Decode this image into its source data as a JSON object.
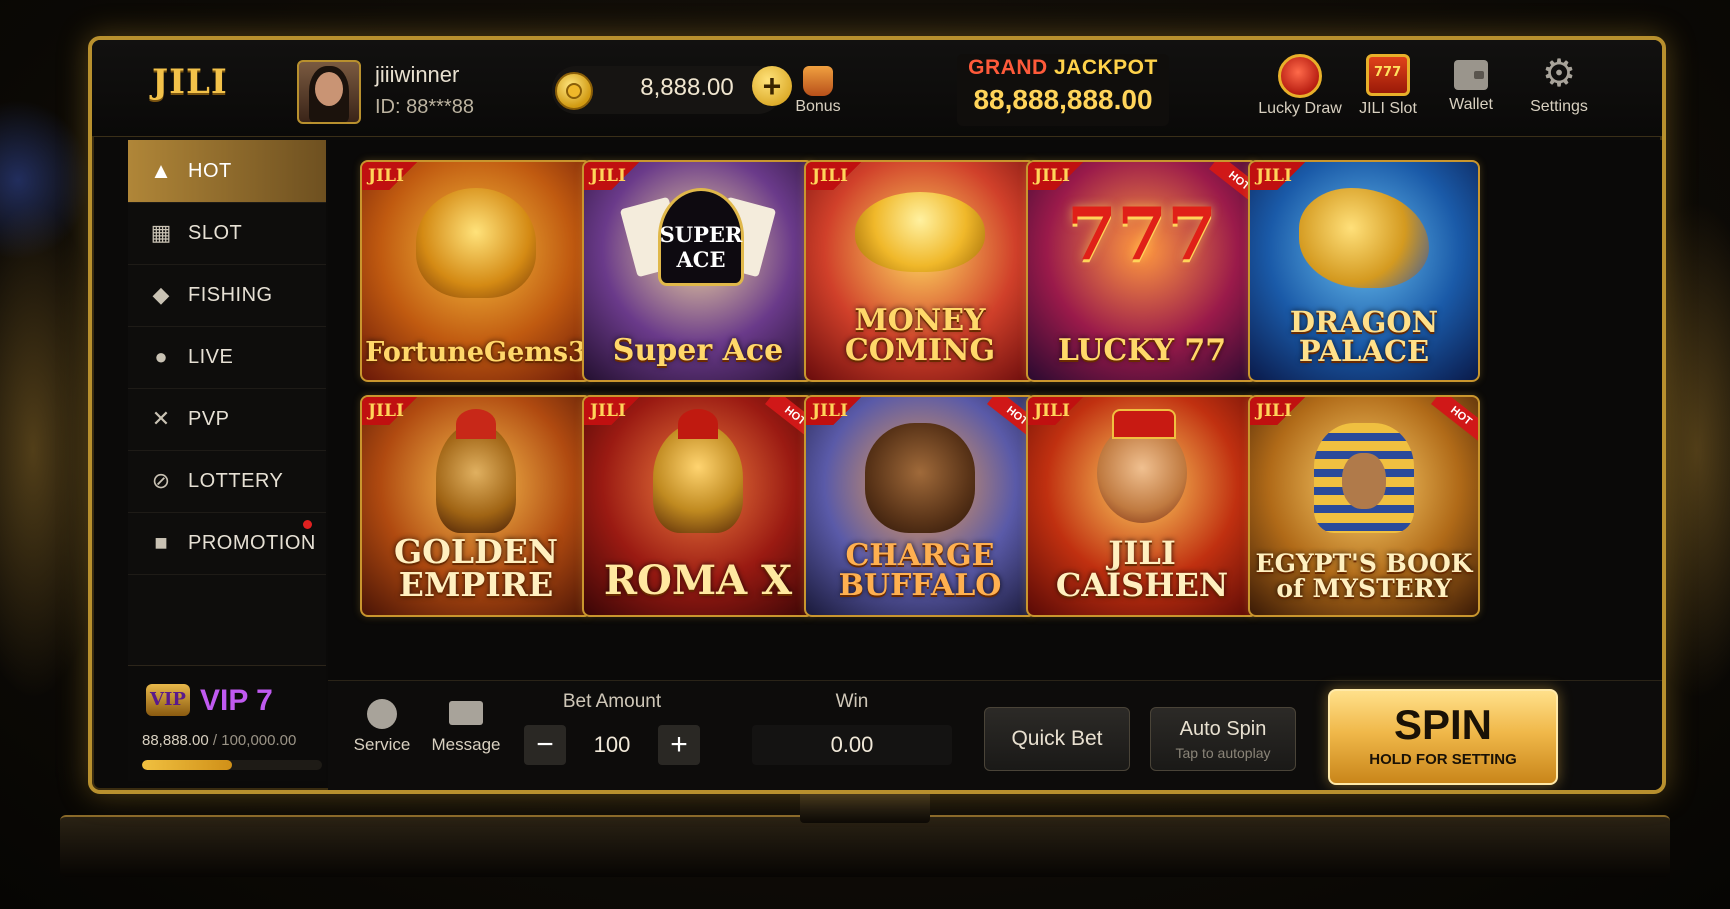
{
  "brand": {
    "logo": "JILI"
  },
  "user": {
    "name": "jiiiwinner",
    "id_label": "ID: 88***88"
  },
  "balance": {
    "amount": "8,888.00",
    "add_icon": "+"
  },
  "bonus": {
    "label": "Bonus"
  },
  "jackpot": {
    "label_part1": "GRAND",
    "label_part2": " JACKPOT",
    "value": "88,888,888.00"
  },
  "top_nav": [
    {
      "label": "Lucky Draw",
      "icon": "lucky-wheel-icon"
    },
    {
      "label": "JILI Slot",
      "icon": "slot-machine-icon",
      "glyph": "777"
    },
    {
      "label": "Wallet",
      "icon": "wallet-icon"
    },
    {
      "label": "Settings",
      "icon": "gear-icon",
      "glyph": "⚙"
    }
  ],
  "sidebar": {
    "items": [
      {
        "label": "HOT",
        "icon": "flame-icon",
        "glyph": "🔥",
        "active": true
      },
      {
        "label": "SLOT",
        "icon": "slot-icon",
        "glyph": "▦"
      },
      {
        "label": "FISHING",
        "icon": "fish-icon",
        "glyph": "◆"
      },
      {
        "label": "LIVE",
        "icon": "person-icon",
        "glyph": "●"
      },
      {
        "label": "PVP",
        "icon": "swords-icon",
        "glyph": "✕"
      },
      {
        "label": "LOTTERY",
        "icon": "lottery-ball-icon",
        "glyph": "⊘"
      },
      {
        "label": "PROMOTION",
        "icon": "gift-icon",
        "glyph": "■",
        "has_notification": true
      }
    ]
  },
  "vip": {
    "badge": "VIP",
    "level": "VIP 7",
    "current": "88,888.00",
    "separator": " / ",
    "target": "100,000.00",
    "progress": 0.5
  },
  "games": [
    {
      "title": "FortuneGems3",
      "tag": "JILI",
      "hot": false
    },
    {
      "title": "Super Ace",
      "subtitle": "SUPER ACE",
      "tag": "JILI",
      "hot": false
    },
    {
      "title": "MONEY COMING",
      "tag": "JILI",
      "hot": false
    },
    {
      "title": "LUCKY 77",
      "subtitle": "777",
      "tag": "JILI",
      "hot": true
    },
    {
      "title": "DRAGON PALACE",
      "tag": "JILI",
      "hot": false
    },
    {
      "title": "GOLDEN EMPIRE",
      "tag": "JILI",
      "hot": false
    },
    {
      "title": "ROMA X",
      "tag": "JILI",
      "hot": true
    },
    {
      "title": "CHARGE BUFFALO",
      "tag": "JILI",
      "hot": true
    },
    {
      "title": "JILI CAISHEN",
      "tag": "JILI",
      "hot": false
    },
    {
      "title": "EGYPT'S BOOK of MYSTERY",
      "tag": "JILI",
      "hot": true
    }
  ],
  "hot_tag_text": "HOT",
  "pagination": {
    "pages": 2,
    "current": 1,
    "active_color": "#f0c040",
    "inactive_color": "#5a5650"
  },
  "bottom": {
    "service": "Service",
    "message": "Message",
    "bet_label": "Bet Amount",
    "bet_value": "100",
    "minus": "−",
    "plus": "+",
    "win_label": "Win",
    "win_value": "0.00",
    "quick_bet": "Quick Bet",
    "auto_spin": "Auto Spin",
    "auto_spin_sub": "Tap to autoplay",
    "spin": "SPIN",
    "spin_sub": "HOLD FOR SETTING"
  },
  "colors": {
    "accent_gold": "#f0c040",
    "vip_purple": "#c05af0",
    "frame_gold": "#b8902e"
  }
}
